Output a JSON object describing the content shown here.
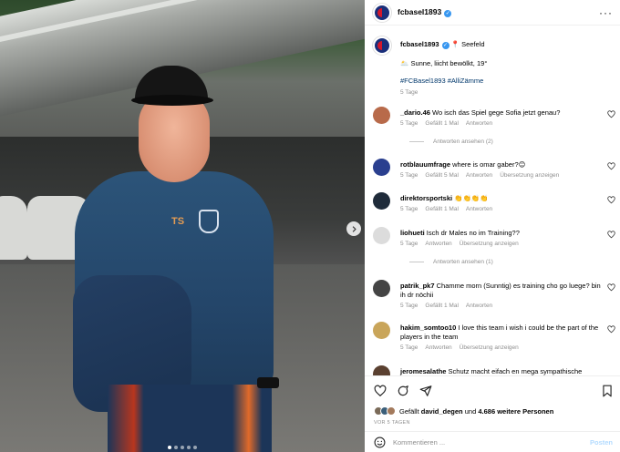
{
  "post": {
    "username": "fcbasel1893",
    "more_icon": "more-horizontal-icon"
  },
  "caption": {
    "username": "fcbasel1893",
    "location_emoji": "📍",
    "location": "Seefeld",
    "weather_emoji": "🌥️",
    "weather": "Sunne, liicht bewölkt, 19°",
    "hashtags": "#FCBasel1893 #AlliZämme",
    "age": "5 Tage"
  },
  "comments": [
    {
      "username": "_dario.46",
      "text": "Wo isch das Spiel gege Sofia jetzt genau?",
      "age": "5 Tage",
      "likes": "Gefällt 1 Mal",
      "reply": "Antworten",
      "translate": "",
      "view_replies": "Antworten ansehen (2)",
      "avatar_color": "#b86a4a"
    },
    {
      "username": "rotblauumfrage",
      "text": "where is omar gaber?😊",
      "age": "5 Tage",
      "likes": "Gefällt 5 Mal",
      "reply": "Antworten",
      "translate": "Übersetzung anzeigen",
      "view_replies": "",
      "avatar_color": "#2a3f8f"
    },
    {
      "username": "direktorsportski",
      "text": "👏👏👏👏",
      "age": "5 Tage",
      "likes": "Gefällt 1 Mal",
      "reply": "Antworten",
      "translate": "",
      "view_replies": "",
      "avatar_color": "#1f2b3a"
    },
    {
      "username": "liohueti",
      "text": "Isch dr Males no im Training??",
      "age": "5 Tage",
      "likes": "",
      "reply": "Antworten",
      "translate": "Übersetzung anzeigen",
      "view_replies": "Antworten ansehen (1)",
      "avatar_color": "#dcdcdc"
    },
    {
      "username": "patrik_pk7",
      "text": "Chamme morn (Sunntig) es training cho go luege? bin ih dr nöchii",
      "age": "5 Tage",
      "likes": "Gefällt 1 Mal",
      "reply": "Antworten",
      "translate": "",
      "view_replies": "",
      "avatar_color": "#444"
    },
    {
      "username": "hakim_somtoo10",
      "text": "I love this team i wish i could be the part of the players in the team",
      "age": "5 Tage",
      "likes": "",
      "reply": "Antworten",
      "translate": "Übersetzung anzeigen",
      "view_replies": "",
      "avatar_color": "#c9a55a"
    },
    {
      "username": "jeromesalathe",
      "text": "Schutz macht eifach en mega sympathische",
      "age": "",
      "likes": "",
      "reply": "",
      "translate": "",
      "view_replies": "",
      "avatar_color": "#5a4030"
    }
  ],
  "actions": {
    "liked_by_prefix": "Gefällt",
    "liked_by_user": "david_degen",
    "liked_by_middle": "und",
    "liked_by_rest": "4.686 weitere Personen",
    "date": "VOR 5 TAGEN"
  },
  "comment_box": {
    "placeholder": "Kommentieren ...",
    "post_label": "Posten"
  },
  "colors": {
    "verified": "#3897f0",
    "hashtag": "#00376b",
    "muted": "#8e8e8e",
    "club_blue": "#1a2f7a",
    "club_red": "#d3172b"
  }
}
